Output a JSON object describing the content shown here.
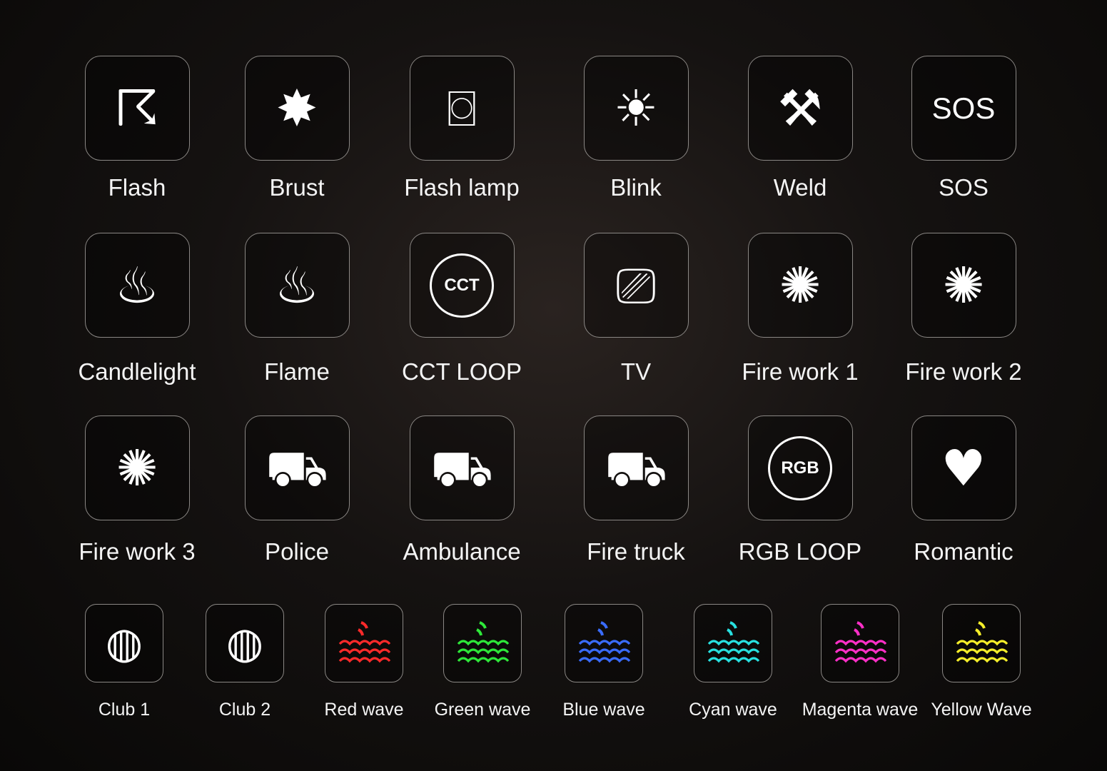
{
  "rows": [
    {
      "size": "big",
      "items": [
        {
          "label": "Flash",
          "icon": "thunder-cloud-icon"
        },
        {
          "label": "Brust",
          "icon": "burst-icon"
        },
        {
          "label": "Flash lamp",
          "icon": "camera-flash-icon"
        },
        {
          "label": "Blink",
          "icon": "lightbulb-icon"
        },
        {
          "label": "Weld",
          "icon": "welding-torch-icon"
        },
        {
          "label": "SOS",
          "icon": "sos-text-icon",
          "icon_text": "SOS"
        }
      ]
    },
    {
      "size": "big",
      "items": [
        {
          "label": "Candlelight",
          "icon": "candle-icon"
        },
        {
          "label": "Flame",
          "icon": "campfire-icon"
        },
        {
          "label": "CCT LOOP",
          "icon": "cct-loop-icon",
          "icon_text": "CCT"
        },
        {
          "label": "TV",
          "icon": "tv-icon"
        },
        {
          "label": "Fire work 1",
          "icon": "firework-icon"
        },
        {
          "label": "Fire work 2",
          "icon": "firework-icon"
        }
      ]
    },
    {
      "size": "big",
      "items": [
        {
          "label": "Fire work 3",
          "icon": "firework-icon"
        },
        {
          "label": "Police",
          "icon": "police-car-icon"
        },
        {
          "label": "Ambulance",
          "icon": "ambulance-icon"
        },
        {
          "label": "Fire truck",
          "icon": "fire-truck-icon"
        },
        {
          "label": "RGB LOOP",
          "icon": "rgb-loop-icon",
          "icon_text": "RGB"
        },
        {
          "label": "Romantic",
          "icon": "couple-heart-icon"
        }
      ]
    },
    {
      "size": "small",
      "items": [
        {
          "label": "Club 1",
          "icon": "disco-ball-icon"
        },
        {
          "label": "Club 2",
          "icon": "disco-ball-icon"
        },
        {
          "label": "Red wave",
          "icon": "wave-icon",
          "color": "#ff2a2a"
        },
        {
          "label": "Green wave",
          "icon": "wave-icon",
          "color": "#2ee83a"
        },
        {
          "label": "Blue wave",
          "icon": "wave-icon",
          "color": "#3a6cff"
        },
        {
          "label": "Cyan wave",
          "icon": "wave-icon",
          "color": "#28e0e0"
        },
        {
          "label": "Magenta wave",
          "icon": "wave-icon",
          "color": "#ff2fc8"
        },
        {
          "label": "Yellow Wave",
          "icon": "wave-icon",
          "color": "#f5ee2a"
        }
      ]
    }
  ]
}
